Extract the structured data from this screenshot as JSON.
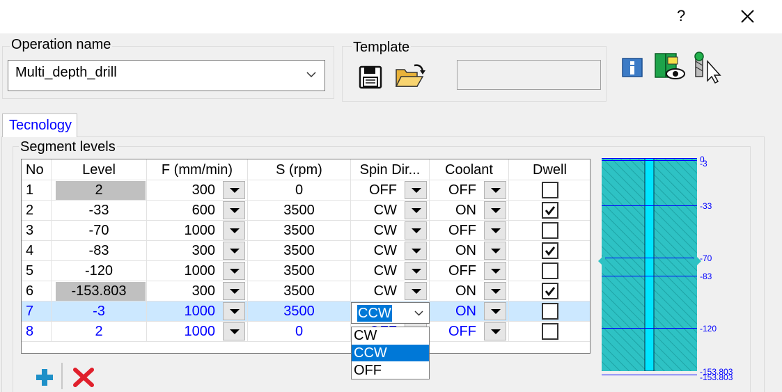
{
  "titlebar": {
    "help": "?",
    "close_icon": "close-icon"
  },
  "operation": {
    "label": "Operation name",
    "value": "Multi_depth_drill"
  },
  "template": {
    "label": "Template",
    "value": ""
  },
  "tab": {
    "label": "Tecnology"
  },
  "segments": {
    "label": "Segment levels",
    "headers": [
      "No",
      "Level",
      "F (mm/min)",
      "S (rpm)",
      "Spin Dir...",
      "Coolant",
      "Dwell"
    ],
    "rows": [
      {
        "no": "1",
        "level": "2",
        "f": "300",
        "s": "0",
        "spin": "OFF",
        "coolant": "OFF",
        "dwell": false,
        "shaded": true,
        "blue": false
      },
      {
        "no": "2",
        "level": "-33",
        "f": "600",
        "s": "3500",
        "spin": "CW",
        "coolant": "ON",
        "dwell": true,
        "shaded": false,
        "blue": false
      },
      {
        "no": "3",
        "level": "-70",
        "f": "1000",
        "s": "3500",
        "spin": "CW",
        "coolant": "OFF",
        "dwell": false,
        "shaded": false,
        "blue": false
      },
      {
        "no": "4",
        "level": "-83",
        "f": "300",
        "s": "3500",
        "spin": "CW",
        "coolant": "ON",
        "dwell": true,
        "shaded": false,
        "blue": false
      },
      {
        "no": "5",
        "level": "-120",
        "f": "1000",
        "s": "3500",
        "spin": "CW",
        "coolant": "OFF",
        "dwell": false,
        "shaded": false,
        "blue": false
      },
      {
        "no": "6",
        "level": "-153.803",
        "f": "300",
        "s": "3500",
        "spin": "CW",
        "coolant": "ON",
        "dwell": true,
        "shaded": true,
        "blue": false
      },
      {
        "no": "7",
        "level": "-3",
        "f": "1000",
        "s": "3500",
        "spin": "CCW",
        "coolant": "ON",
        "dwell": false,
        "shaded": false,
        "blue": true
      },
      {
        "no": "8",
        "level": "2",
        "f": "1000",
        "s": "0",
        "spin": "OFF",
        "coolant": "OFF",
        "dwell": false,
        "shaded": false,
        "blue": true
      }
    ],
    "editing_row": 6
  },
  "spin_dropdown": {
    "value": "CCW",
    "options": [
      "CW",
      "CCW",
      "OFF"
    ],
    "selected": "CCW"
  },
  "preview": {
    "labels": [
      {
        "text": "0"
      },
      {
        "text": "-3"
      },
      {
        "text": "-33"
      },
      {
        "text": "-70"
      },
      {
        "text": "-83"
      },
      {
        "text": "-120"
      },
      {
        "text": "-153.803"
      },
      {
        "text": "-153.803"
      }
    ]
  },
  "colors": {
    "accent": "#0078d7",
    "link_blue": "#0000ff",
    "preview_fill": "#2ec2c4",
    "add": "#1e90c8",
    "delete": "#e0202c"
  }
}
